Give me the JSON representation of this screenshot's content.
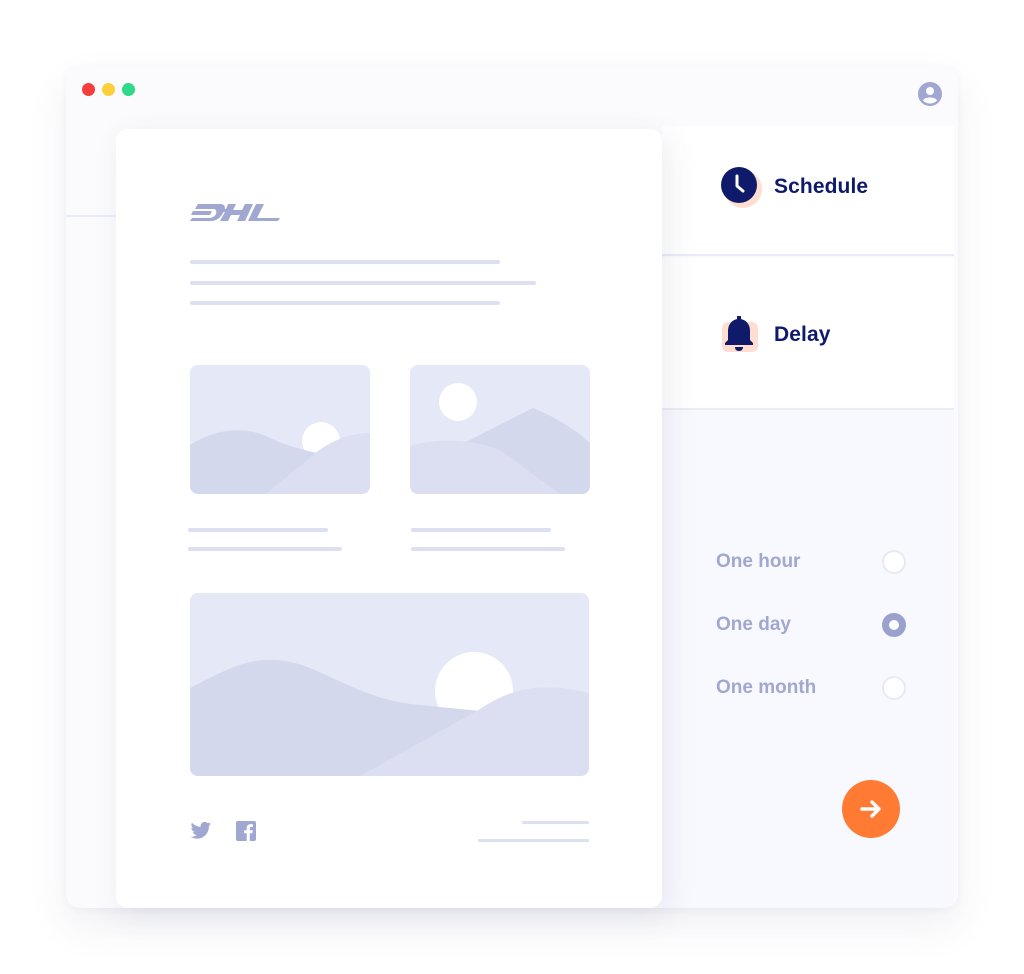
{
  "window": {
    "traffic_lights": [
      "close",
      "minimize",
      "maximize"
    ],
    "colors": {
      "red": "#f53d3d",
      "yellow": "#fdcf3a",
      "green": "#2fd98a"
    },
    "user_icon": "user-circle-icon"
  },
  "email": {
    "brand": "DHL",
    "brand_color": "#a0a7d0",
    "placeholder_color": "#dde0f0",
    "image_bg": "#e5e8f7",
    "social": [
      "twitter-icon",
      "facebook-icon"
    ]
  },
  "panel": {
    "actions": [
      {
        "label": "Schedule",
        "icon": "clock-icon"
      },
      {
        "label": "Delay",
        "icon": "bell-icon"
      }
    ],
    "options": [
      {
        "label": "One hour",
        "selected": false
      },
      {
        "label": "One day",
        "selected": true
      },
      {
        "label": "One month",
        "selected": false
      }
    ],
    "next_button": {
      "icon": "arrow-right-icon",
      "color": "#ff7a33"
    },
    "accent": "#0f1a6b",
    "highlight": "#ffe0d4"
  }
}
